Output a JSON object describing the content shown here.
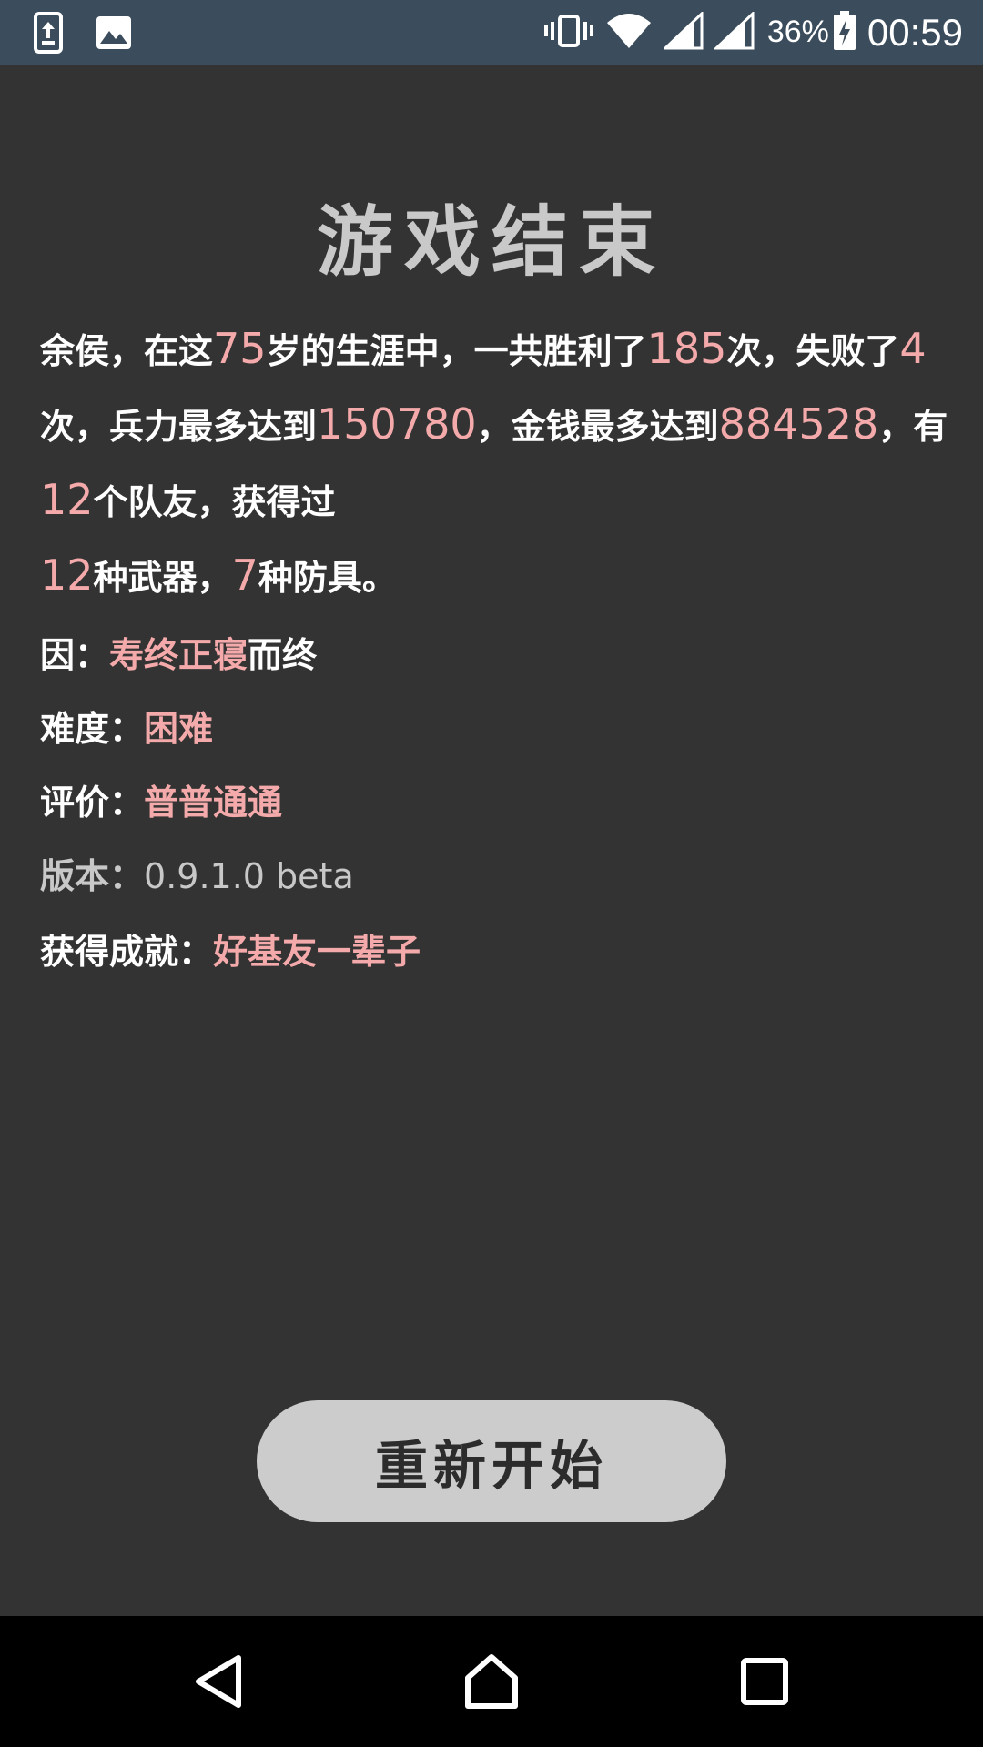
{
  "status_bar": {
    "battery_percent": "36%",
    "time": "00:59",
    "icons": [
      "upload-notification-icon",
      "image-notification-icon",
      "vibrate-icon",
      "wifi-icon",
      "signal-icon",
      "signal-icon",
      "battery-charging-icon"
    ]
  },
  "title": "游戏结束",
  "summary": {
    "t1": "余侯，在这",
    "age": "75",
    "t2": "岁的生涯中，一共胜利了",
    "wins": "185",
    "t3": "次，失败了",
    "losses": "4",
    "t4": "次，兵力最多达到",
    "max_troops": "150780",
    "t5": "，金钱最多达到",
    "max_money": "884528",
    "t6": "，有",
    "teammates": "12",
    "t7": "个队友，获得过",
    "weapons": "12",
    "t8": "种武器，",
    "armors": "7",
    "t9": "种防具。"
  },
  "cause": {
    "label": "因：",
    "value": "寿终正寝",
    "suffix": "而终"
  },
  "difficulty": {
    "label": "难度：",
    "value": "困难"
  },
  "rating": {
    "label": "评价：",
    "value": "普普通通"
  },
  "version": {
    "label": "版本：",
    "value": "0.9.1.0 beta"
  },
  "achievement": {
    "label": "获得成就：",
    "value": "好基友一辈子"
  },
  "restart_button": "重新开始",
  "colors": {
    "background": "#333333",
    "status_bar": "#3b4d5c",
    "highlight": "#f4a9aa",
    "button": "#cccccc"
  }
}
